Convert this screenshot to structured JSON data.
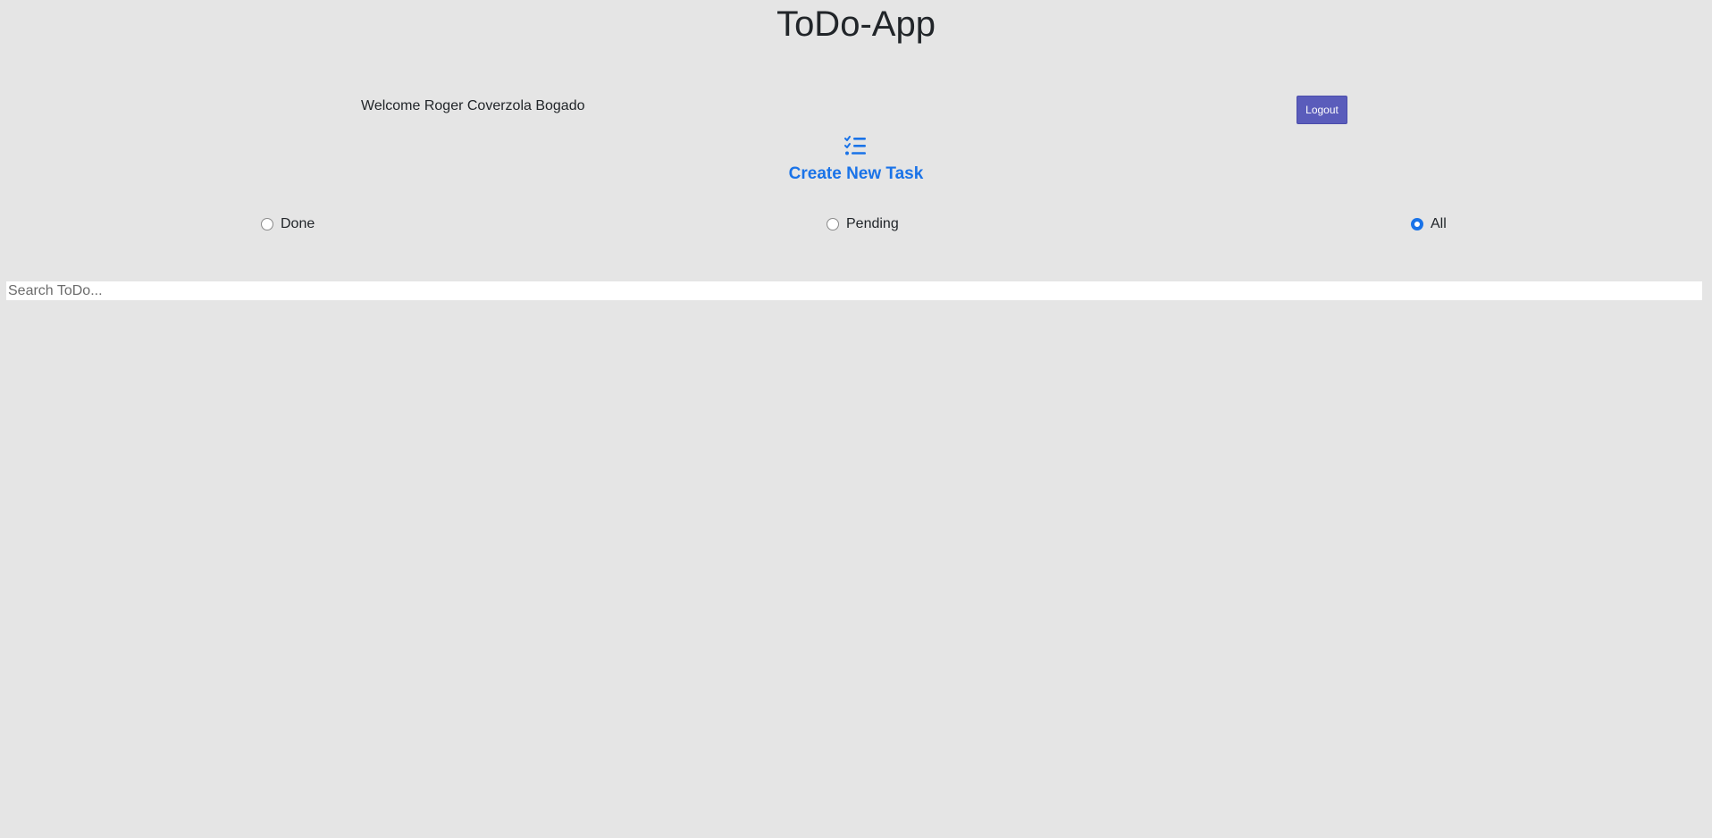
{
  "header": {
    "title": "ToDo-App"
  },
  "user": {
    "welcome_text": "Welcome Roger Coverzola Bogado",
    "logout_label": "Logout"
  },
  "create_task": {
    "icon": "checklist-icon",
    "label": "Create New Task"
  },
  "filters": [
    {
      "label": "Done",
      "checked": false
    },
    {
      "label": "Pending",
      "checked": false
    },
    {
      "label": "All",
      "checked": true
    }
  ],
  "search": {
    "value": "",
    "placeholder": "Search ToDo..."
  },
  "colors": {
    "background": "#e5e5e5",
    "accent": "#1a73e8",
    "logout_button": "#5a5cbb"
  }
}
